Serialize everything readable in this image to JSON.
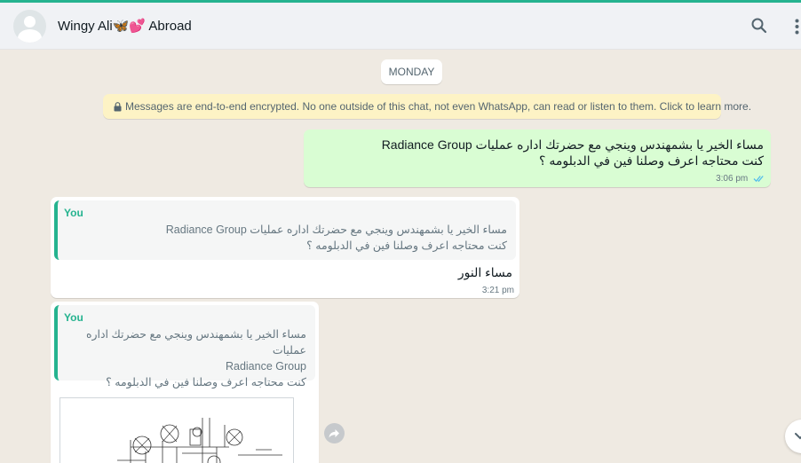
{
  "header": {
    "contact_name": "Wingy Ali🦋💕 Abroad"
  },
  "chat": {
    "date_divider": "MONDAY",
    "encryption_notice": "Messages are end-to-end encrypted. No one outside of this chat, not even WhatsApp, can read or listen to them. Click to learn more.",
    "messages": [
      {
        "direction": "outgoing",
        "lines": [
          "مساء الخير يا بشمهندس وينجي  مع حضرتك اداره عمليات Radiance Group",
          "كنت محتاجه اعرف وصلنا فين في الدبلومه  ؟"
        ],
        "time": "3:06 pm",
        "status_icon": "double-check-read-icon"
      },
      {
        "direction": "incoming",
        "quote_author": "You",
        "quote_lines": [
          "مساء الخير يا بشمهندس وينجي  مع حضرتك اداره عمليات Radiance Group",
          "كنت محتاجه اعرف وصلنا فين في الدبلومه  ؟"
        ],
        "text": "مساء النور",
        "time": "3:21 pm"
      },
      {
        "direction": "incoming",
        "quote_author": "You",
        "quote_lines": [
          "مساء الخير يا بشمهندس وينجي  مع حضرتك اداره عمليات",
          "Radiance Group",
          "كنت محتاجه اعرف وصلنا فين في الدبلومه  ؟"
        ],
        "attachment": "architectural-drawing-image"
      }
    ]
  },
  "colors": {
    "accent": "#25b38f",
    "outgoing_bubble": "#d9fdd3",
    "incoming_bubble": "#ffffff",
    "chat_background": "#efeae2",
    "encryption_chip": "#fdf3c5",
    "read_ticks": "#53bdeb"
  }
}
